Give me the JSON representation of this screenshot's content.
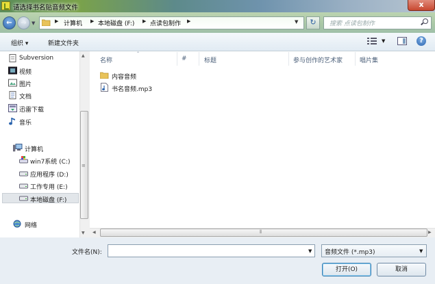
{
  "window": {
    "title": "请选择书名贴音频文件",
    "close_label": "x"
  },
  "nav": {
    "back_icon": "arrow-left-icon",
    "forward_icon": "arrow-right-icon",
    "breadcrumbs": [
      "计算机",
      "本地磁盘 (F:)",
      "点读包制作"
    ],
    "refresh_icon": "refresh-icon",
    "search_placeholder": "搜索 点读包制作"
  },
  "toolbar": {
    "organize_label": "组织 ▾",
    "new_folder_label": "新建文件夹",
    "help_label": "?"
  },
  "sidebar": {
    "items": [
      {
        "label": "Subversion",
        "icon": "subversion-icon"
      },
      {
        "label": "视频",
        "icon": "video-library-icon"
      },
      {
        "label": "图片",
        "icon": "picture-library-icon"
      },
      {
        "label": "文档",
        "icon": "document-library-icon"
      },
      {
        "label": "迅雷下载",
        "icon": "download-library-icon"
      },
      {
        "label": "音乐",
        "icon": "music-library-icon"
      }
    ],
    "computer_label": "计算机",
    "drives": [
      {
        "label": "win7系统 (C:)",
        "icon": "system-drive-icon"
      },
      {
        "label": "应用程序 (D:)",
        "icon": "drive-icon"
      },
      {
        "label": "工作专用 (E:)",
        "icon": "drive-icon"
      },
      {
        "label": "本地磁盘 (F:)",
        "icon": "drive-icon",
        "selected": true
      }
    ],
    "network_label": "网络"
  },
  "file_list": {
    "columns": [
      "名称",
      "#",
      "标题",
      "参与创作的艺术家",
      "唱片集"
    ],
    "files": [
      {
        "name": "内容音频",
        "icon": "folder-icon"
      },
      {
        "name": "书名音频.mp3",
        "icon": "audio-file-icon"
      }
    ]
  },
  "footer": {
    "filename_label": "文件名(N):",
    "filename_value": "",
    "filetype_value": "音频文件 (*.mp3)",
    "open_label": "打开(O)",
    "cancel_label": "取消"
  },
  "colors": {
    "accent": "#3c7fb1",
    "selection": "#e2e6ea",
    "column_header_text": "#4c607a"
  }
}
